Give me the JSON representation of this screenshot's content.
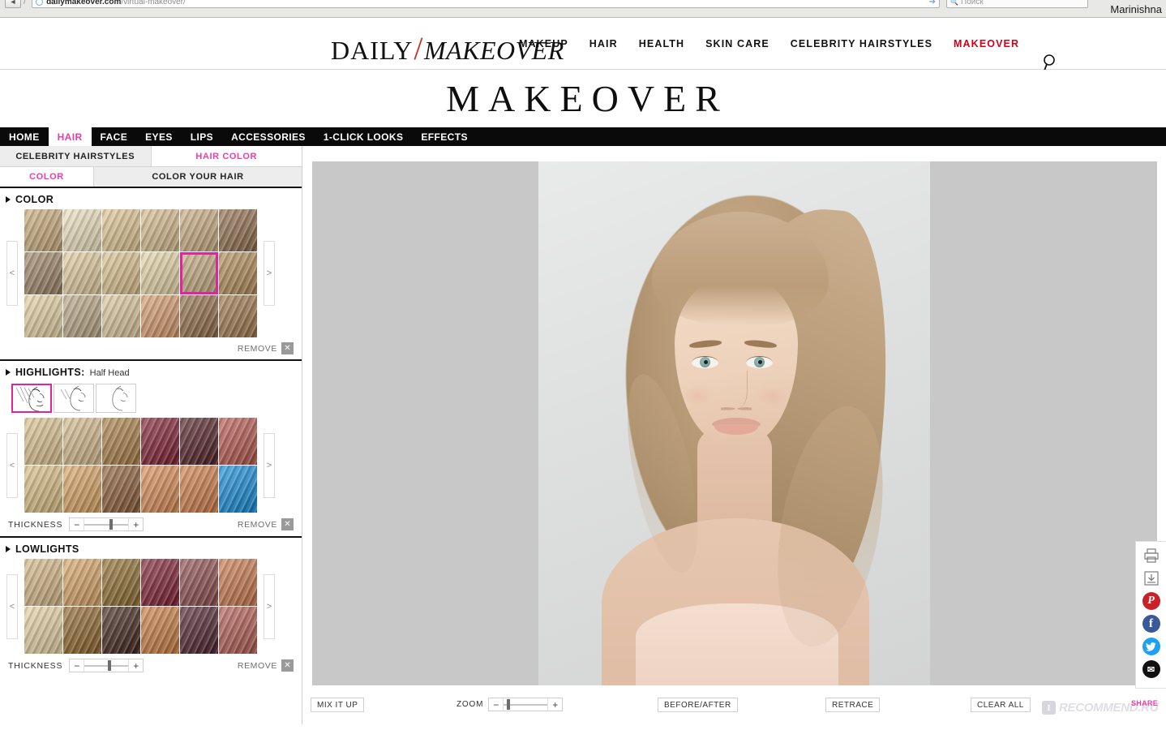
{
  "browser": {
    "url_bold": "dailymakeover.com",
    "url_dim": "/virtual-makeover/",
    "search_placeholder": "Поиск",
    "user_label": "Marinishna",
    "back_icon": "back-arrow-icon",
    "globe_icon": "globe-icon",
    "go_icon": "go-arrow-icon",
    "search_icon": "search-icon"
  },
  "header": {
    "brand_first": "DAILY",
    "brand_slash": "/",
    "brand_second": "MAKEOVER",
    "nav": [
      {
        "label": "MAKEUP",
        "active": false
      },
      {
        "label": "HAIR",
        "active": false
      },
      {
        "label": "HEALTH",
        "active": false
      },
      {
        "label": "SKIN CARE",
        "active": false
      },
      {
        "label": "CELEBRITY HAIRSTYLES",
        "active": false
      },
      {
        "label": "MAKEOVER",
        "active": true
      }
    ],
    "search_icon": "magnifier-icon",
    "accent_red": "#d0021b"
  },
  "page_title": "MAKEOVER",
  "black_tabs": [
    {
      "label": "HOME",
      "active": false
    },
    {
      "label": "HAIR",
      "active": true
    },
    {
      "label": "FACE",
      "active": false
    },
    {
      "label": "EYES",
      "active": false
    },
    {
      "label": "LIPS",
      "active": false
    },
    {
      "label": "ACCESSORIES",
      "active": false
    },
    {
      "label": "1-CLICK LOOKS",
      "active": false
    },
    {
      "label": "EFFECTS",
      "active": false
    }
  ],
  "subtabs_primary": [
    {
      "label": "CELEBRITY HAIRSTYLES",
      "active": false
    },
    {
      "label": "HAIR COLOR",
      "active": true
    }
  ],
  "subtabs_secondary": [
    {
      "label": "COLOR",
      "active": true
    },
    {
      "label": "COLOR YOUR HAIR",
      "active": false
    }
  ],
  "accent_pink": "#e83fa8",
  "sections": {
    "color": {
      "title": "COLOR",
      "prev_label": "<",
      "next_label": ">",
      "remove_label": "REMOVE",
      "remove_icon": "close-x-icon",
      "selected_index": 10,
      "swatches": [
        "#c9a979",
        "#efe2bd",
        "#e0c590",
        "#d7bb8c",
        "#c9ab80",
        "#8e6b49",
        "#9b8162",
        "#e3cb9c",
        "#dcc08b",
        "#e6d5a6",
        "#c4a87e",
        "#b08a56",
        "#e6d2a3",
        "#b9a583",
        "#dcc79c",
        "#d79a6b",
        "#8f6a45",
        "#9d7549"
      ]
    },
    "highlights": {
      "title": "HIGHLIGHTS:",
      "subtitle": "Half Head",
      "patterns": [
        {
          "name": "half-head-pattern",
          "selected": true
        },
        {
          "name": "partial-pattern",
          "selected": false
        },
        {
          "name": "minimal-pattern",
          "selected": false
        }
      ],
      "prev_label": "<",
      "next_label": ">",
      "thickness_label": "THICKNESS",
      "minus_label": "−",
      "plus_label": "+",
      "thickness_value": 62,
      "remove_label": "REMOVE",
      "remove_icon": "close-x-icon",
      "swatches": [
        "#ddc38f",
        "#d6ba8b",
        "#a97c42",
        "#7d1b2e",
        "#4e1c22",
        "#b5544a",
        "#d9bd82",
        "#d9a361",
        "#8a5a33",
        "#d98a52",
        "#cf7b45",
        "#1189d6"
      ]
    },
    "lowlights": {
      "title": "LOWLIGHTS",
      "prev_label": "<",
      "next_label": ">",
      "thickness_label": "THICKNESS",
      "minus_label": "−",
      "plus_label": "+",
      "thickness_value": 58,
      "remove_label": "REMOVE",
      "remove_icon": "close-x-icon",
      "swatches": [
        "#d5b684",
        "#d9a364",
        "#8d6a2b",
        "#7c1c2d",
        "#8b4a4c",
        "#c9764a",
        "#e6d2a2",
        "#8d6327",
        "#3d2118",
        "#c97b3f",
        "#4a1f2b",
        "#b05a4e"
      ]
    }
  },
  "toolbar": {
    "mix_it_up": "MIX IT UP",
    "zoom_label": "ZOOM",
    "zoom_minus": "−",
    "zoom_plus": "+",
    "zoom_value": 8,
    "before_after": "BEFORE/AFTER",
    "retrace": "RETRACE",
    "clear_all": "CLEAR ALL",
    "share": "SHARE"
  },
  "social_rail": [
    {
      "name": "print-icon",
      "glyph": "⎙",
      "bg": "transparent",
      "fg": "#777"
    },
    {
      "name": "save-icon",
      "glyph": "⤓",
      "bg": "transparent",
      "fg": "#777"
    },
    {
      "name": "pinterest-icon",
      "glyph": "P",
      "bg": "#cb2027",
      "fg": "#ffffff"
    },
    {
      "name": "facebook-icon",
      "glyph": "f",
      "bg": "#3b5998",
      "fg": "#ffffff"
    },
    {
      "name": "twitter-icon",
      "glyph": "t",
      "bg": "#1da1f2",
      "fg": "#ffffff"
    },
    {
      "name": "email-icon",
      "glyph": "✉",
      "bg": "#111111",
      "fg": "#ffffff"
    }
  ],
  "watermark": {
    "badge": "I",
    "text": "RECOMMEND.RU"
  }
}
